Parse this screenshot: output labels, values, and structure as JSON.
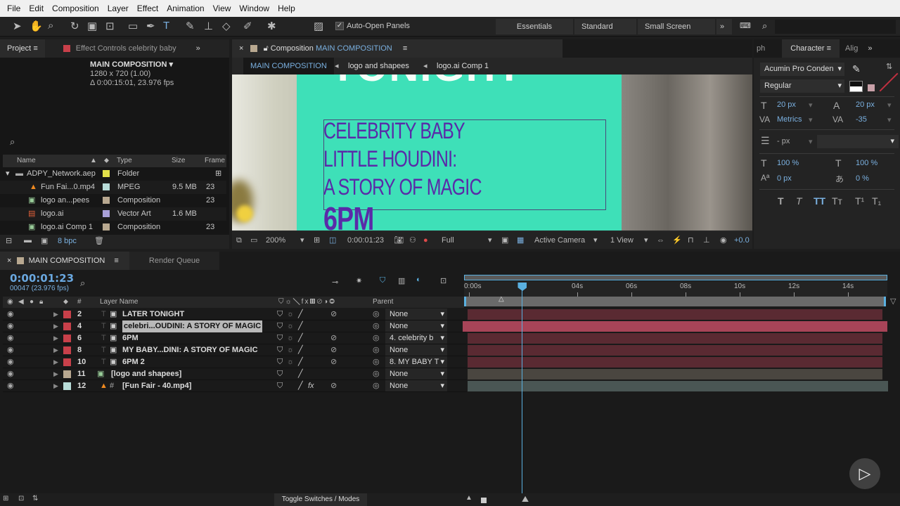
{
  "menu": [
    "File",
    "Edit",
    "Composition",
    "Layer",
    "Effect",
    "Animation",
    "View",
    "Window",
    "Help"
  ],
  "toolbar": {
    "auto_open": "Auto-Open Panels",
    "workspaces": [
      "Essentials",
      "Standard",
      "Small Screen"
    ]
  },
  "project": {
    "tab": "Project",
    "effect_tab": "Effect Controls celebrity baby",
    "comp_name": "MAIN COMPOSITION",
    "comp_size": "1280 x 720 (1.00)",
    "comp_duration": "Δ 0:00:15:01, 23.976 fps",
    "columns": [
      "Name",
      "Type",
      "Size",
      "Frame"
    ],
    "items": [
      {
        "name": "ADPY_Network.aep",
        "type": "Folder",
        "size": "",
        "frame": "",
        "color": "#e2e04a"
      },
      {
        "name": "Fun Fai...0.mp4",
        "type": "MPEG",
        "size": "9.5 MB",
        "frame": "23",
        "color": "#b8dcd8"
      },
      {
        "name": "logo an...pees",
        "type": "Composition",
        "size": "",
        "frame": "23",
        "color": "#b8a890"
      },
      {
        "name": "logo.ai",
        "type": "Vector Art",
        "size": "1.6 MB",
        "frame": "",
        "color": "#a8a0d8"
      },
      {
        "name": "logo.ai Comp 1",
        "type": "Composition",
        "size": "",
        "frame": "23",
        "color": "#b8a890"
      }
    ],
    "bpc": "8 bpc"
  },
  "viewer": {
    "tab_prefix": "Composition",
    "tab_name": "MAIN COMPOSITION",
    "breadcrumbs": [
      "MAIN COMPOSITION",
      "logo and shapees",
      "logo.ai Comp 1"
    ],
    "canvas_text": {
      "top": "TONIGHT",
      "lines": [
        "CELEBRITY BABY",
        "LITTLE HOUDINI:",
        "A STORY OF MAGIC"
      ],
      "time": "6PM"
    },
    "zoom": "200%",
    "timecode": "0:00:01:23",
    "resolution": "Full",
    "camera": "Active Camera",
    "views": "1 View",
    "exposure": "+0.0"
  },
  "character": {
    "tabs": [
      "ph",
      "Character",
      "Alig"
    ],
    "font": "Acumin Pro Conden",
    "style": "Regular",
    "size": "20 px",
    "leading": "20 px",
    "kerning": "Metrics",
    "tracking": "-35",
    "stroke": "- px",
    "vscale": "100 %",
    "hscale": "100 %",
    "baseline": "0 px",
    "tsume": "0 %"
  },
  "timeline": {
    "tab": "MAIN COMPOSITION",
    "render_tab": "Render Queue",
    "timecode": "0:00:01:23",
    "frames": "00047 (23.976 fps)",
    "headers": {
      "num": "#",
      "name": "Layer Name",
      "parent": "Parent"
    },
    "ruler": [
      "0:00s",
      "04s",
      "06s",
      "08s",
      "10s",
      "12s",
      "14s"
    ],
    "current_time_s": 1.96,
    "layers": [
      {
        "num": "2",
        "name": "LATER TONIGHT",
        "parent": "None",
        "color": "#c8404a",
        "kind": "text"
      },
      {
        "num": "4",
        "name": "celebri...OUDINI: A STORY OF MAGIC",
        "parent": "None",
        "color": "#c8404a",
        "kind": "text",
        "selected": true
      },
      {
        "num": "6",
        "name": "6PM",
        "parent": "4. celebrity b",
        "color": "#c8404a",
        "kind": "text"
      },
      {
        "num": "8",
        "name": "MY BABY...DINI: A STORY OF MAGIC",
        "parent": "None",
        "color": "#c8404a",
        "kind": "text"
      },
      {
        "num": "10",
        "name": "6PM 2",
        "parent": "8. MY BABY T",
        "color": "#c8404a",
        "kind": "text"
      },
      {
        "num": "11",
        "name": "[logo and shapees]",
        "parent": "None",
        "color": "#b8a890",
        "kind": "comp"
      },
      {
        "num": "12",
        "name": "[Fun Fair - 40.mp4]",
        "parent": "None",
        "color": "#b8dcd8",
        "kind": "video"
      }
    ],
    "toggle": "Toggle Switches / Modes"
  }
}
